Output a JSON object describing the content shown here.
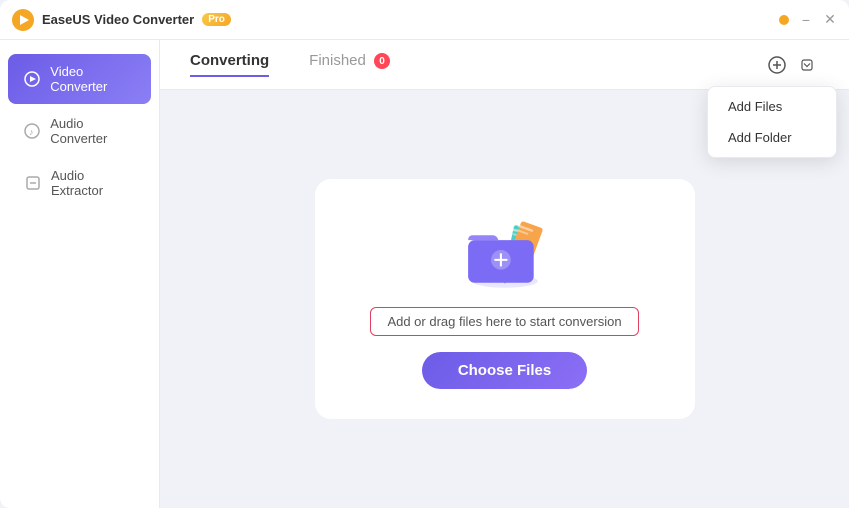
{
  "window": {
    "title": "EaseUS Video Converter",
    "pro_badge": "Pro"
  },
  "titlebar": {
    "minimize_label": "−",
    "close_label": "✕"
  },
  "sidebar": {
    "items": [
      {
        "id": "video-converter",
        "label": "Video Converter",
        "icon": "▶",
        "active": true
      },
      {
        "id": "audio-converter",
        "label": "Audio Converter",
        "icon": "♪",
        "active": false
      },
      {
        "id": "audio-extractor",
        "label": "Audio Extractor",
        "icon": "⊡",
        "active": false
      }
    ]
  },
  "tabs": {
    "converting": {
      "label": "Converting",
      "active": true
    },
    "finished": {
      "label": "Finished",
      "badge": "0",
      "active": false
    }
  },
  "dropzone": {
    "hint_text": "Add or drag files here to start conversion",
    "choose_files_label": "Choose Files"
  },
  "dropdown": {
    "visible": true,
    "items": [
      {
        "id": "add-files",
        "label": "Add Files"
      },
      {
        "id": "add-folder",
        "label": "Add Folder"
      }
    ]
  },
  "colors": {
    "accent": "#6c5ce7",
    "badge_red": "#ff4757",
    "folder_main": "#7c6cf5",
    "folder_doc1": "#4ecdc4",
    "folder_doc2": "#f7a44a"
  }
}
